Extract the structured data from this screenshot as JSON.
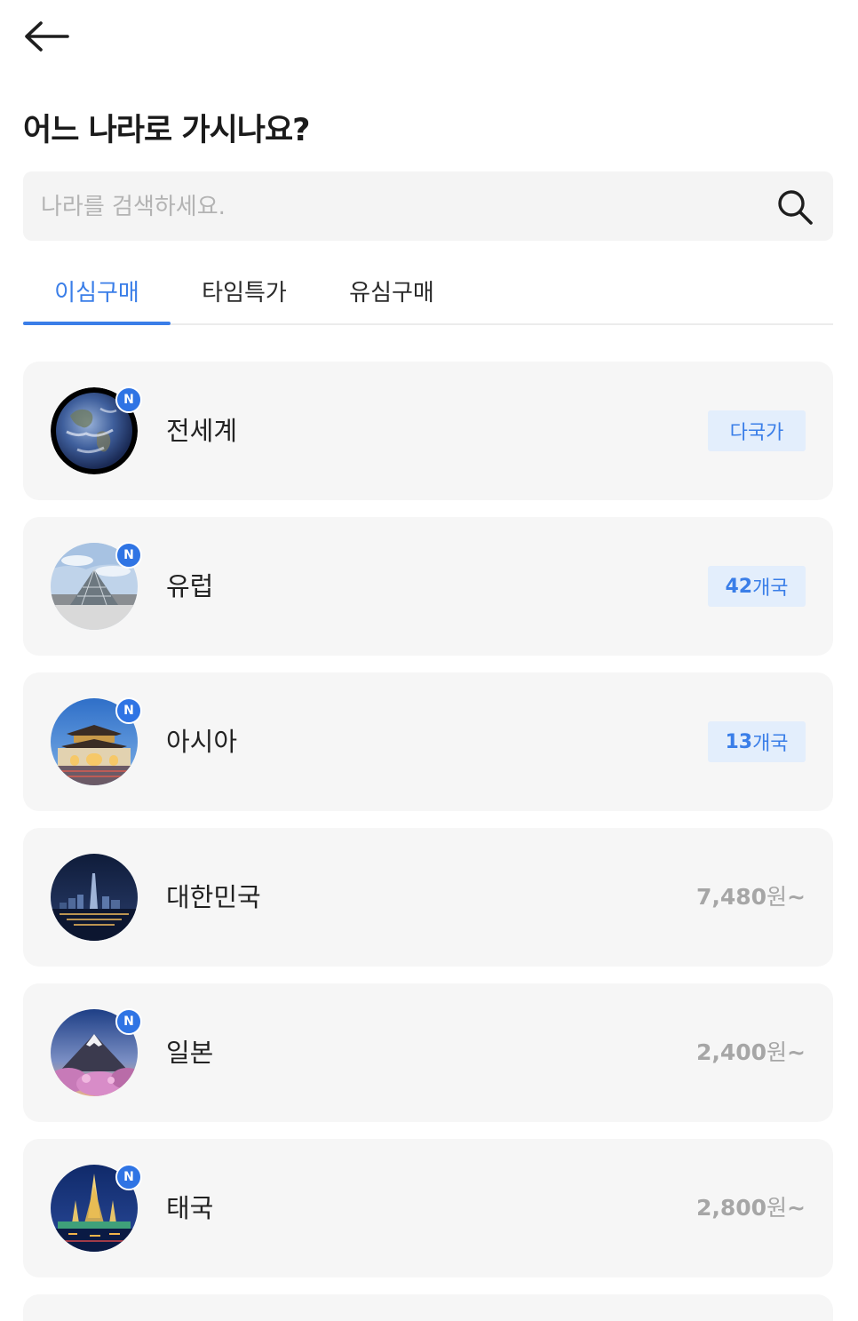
{
  "header": {
    "back_icon": "arrow-left-icon",
    "title": "어느 나라로 가시나요?"
  },
  "search": {
    "placeholder": "나라를 검색하세요.",
    "value": "",
    "icon": "search-icon"
  },
  "tabs": [
    {
      "label": "이심구매",
      "active": true
    },
    {
      "label": "타임특가",
      "active": false
    },
    {
      "label": "유심구매",
      "active": false
    }
  ],
  "countries": [
    {
      "name": "전세계",
      "is_new": true,
      "new_label": "N",
      "badge_text": "다국가",
      "image": "earth-globe"
    },
    {
      "name": "유럽",
      "is_new": true,
      "new_label": "N",
      "badge_num": "42",
      "badge_unit": "개국",
      "image": "louvre-pyramid"
    },
    {
      "name": "아시아",
      "is_new": true,
      "new_label": "N",
      "badge_num": "13",
      "badge_unit": "개국",
      "image": "palace-gate-night"
    },
    {
      "name": "대한민국",
      "is_new": false,
      "price_num": "7,480",
      "price_unit": "원",
      "price_suffix": "~",
      "image": "city-skyline-night"
    },
    {
      "name": "일본",
      "is_new": true,
      "new_label": "N",
      "price_num": "2,400",
      "price_unit": "원",
      "price_suffix": "~",
      "image": "mount-fuji-blossoms"
    },
    {
      "name": "태국",
      "is_new": true,
      "new_label": "N",
      "price_num": "2,800",
      "price_unit": "원",
      "price_suffix": "~",
      "image": "temple-night"
    }
  ],
  "colors": {
    "accent": "#3a7ee8",
    "new_badge": "#2f74e4",
    "badge_bg": "#e3eefc",
    "card_bg": "#f6f6f6",
    "price_text": "#a6a6a6"
  }
}
